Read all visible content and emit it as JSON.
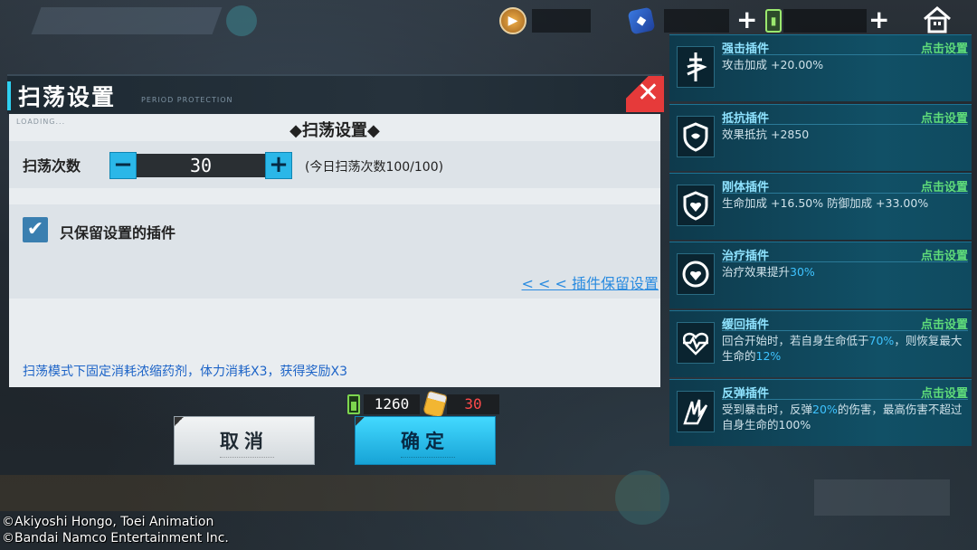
{
  "topbar": {
    "coin_icon": "play-coin-icon",
    "gem_icon": "gem-cube-icon",
    "battery_icon": "battery-icon",
    "home_icon": "home-icon"
  },
  "dialog": {
    "title": "扫荡设置",
    "subtitle": "PERIOD PROTECTION",
    "loading_text": "LOADING...",
    "section_title": "◆扫荡设置◆",
    "count_label": "扫荡次数",
    "count_value": "30",
    "count_note": "(今日扫荡次数100/100)",
    "keep_checked": true,
    "keep_label": "只保留设置的插件",
    "keep_link": "< < < 插件保留设置",
    "info_text": "扫荡模式下固定消耗浓缩药剂，体力消耗X3，获得奖励X3",
    "stamina_cost": "1260",
    "potion_cost": "30",
    "cancel_label": "取消",
    "confirm_label": "确定",
    "accent_color": "#2bb7e8",
    "close_color": "#e63a3a"
  },
  "plugins": [
    {
      "name": "强击插件",
      "action": "点击设置",
      "icon": "sword-icon",
      "desc": [
        "攻击加成 +20.00%"
      ]
    },
    {
      "name": "抵抗插件",
      "action": "点击设置",
      "icon": "shield-icon",
      "desc": [
        "效果抵抗 +2850"
      ]
    },
    {
      "name": "刚体插件",
      "action": "点击设置",
      "icon": "heart-shield-icon",
      "desc": [
        "生命加成 +16.50% 防御加成 +33.00%"
      ]
    },
    {
      "name": "治疗插件",
      "action": "点击设置",
      "icon": "heal-heart-icon",
      "desc_pre": "治疗效果提升",
      "desc_hl": "30%"
    },
    {
      "name": "缓回插件",
      "action": "点击设置",
      "icon": "heartbeat-icon",
      "desc_pre": "回合开始时，若自身生命低于",
      "desc_hl": "70%",
      "desc_mid": "，则恢复最大生命的",
      "desc_hl2": "12%"
    },
    {
      "name": "反弹插件",
      "action": "点击设置",
      "icon": "rebound-claw-icon",
      "desc_pre": "受到暴击时，反弹",
      "desc_hl": "20%",
      "desc_mid": "的伤害，最高伤害不超过自身生命的100%"
    }
  ],
  "copyright": [
    "©Akiyoshi Hongo, Toei Animation",
    "©Bandai Namco Entertainment Inc."
  ]
}
